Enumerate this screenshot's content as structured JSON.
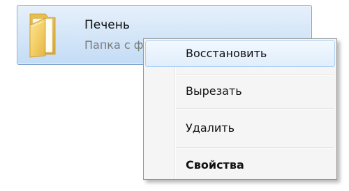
{
  "file_item": {
    "name": "Печень",
    "type_label": "Папка с ф",
    "icon": "folder-icon",
    "selected": true
  },
  "context_menu": {
    "items": [
      {
        "label": "Восстановить",
        "highlighted": true,
        "bold": false
      },
      {
        "label": "Вырезать",
        "highlighted": false,
        "bold": false
      },
      {
        "label": "Удалить",
        "highlighted": false,
        "bold": false
      },
      {
        "label": "Свойства",
        "highlighted": false,
        "bold": true
      }
    ]
  },
  "colors": {
    "selection_border": "#7da2ce",
    "selection_fill": "#d3e5f8",
    "menu_background": "#f5f5f5",
    "menu_highlight_border": "#aecff7",
    "folder": "#f0c75a"
  }
}
